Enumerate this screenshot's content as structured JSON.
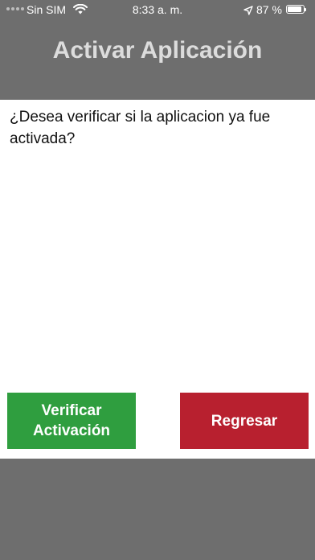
{
  "status_bar": {
    "carrier": "Sin SIM",
    "time": "8:33 a. m.",
    "battery_percent": "87 %",
    "battery_level": 0.87,
    "icons": [
      "signal-dots-icon",
      "wifi-icon",
      "location-arrow-icon",
      "battery-icon"
    ]
  },
  "header": {
    "title": "Activar Aplicación"
  },
  "main": {
    "question": "¿Desea verificar si la aplicacion ya fue activada?"
  },
  "buttons": {
    "verify_label": "Verificar Activación",
    "back_label": "Regresar"
  },
  "colors": {
    "bar_gray": "#6e6e6e",
    "title_text": "#dcdcdc",
    "verify_green": "#2f9e3f",
    "back_red": "#b8202f",
    "content_bg": "#ffffff"
  }
}
